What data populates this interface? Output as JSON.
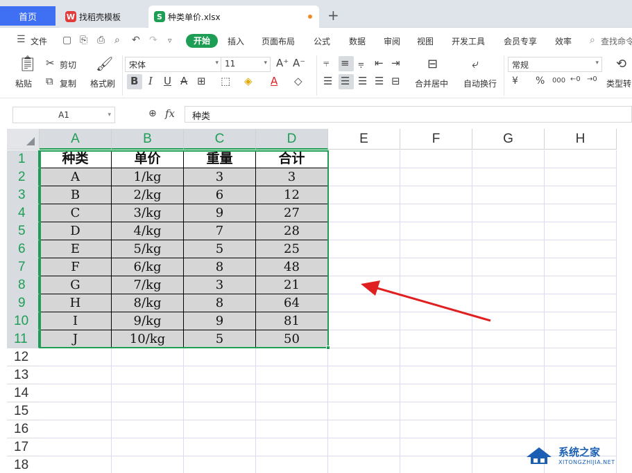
{
  "tabs": {
    "home": "首页",
    "template": "找稻壳模板",
    "file": "种类单价.xlsx",
    "add": "+"
  },
  "menu": {
    "file": "文件",
    "items": [
      "开始",
      "插入",
      "页面布局",
      "公式",
      "数据",
      "审阅",
      "视图",
      "开发工具",
      "会员专享",
      "效率"
    ],
    "search": "查找命令"
  },
  "ribbon": {
    "paste": "粘贴",
    "cut": "剪切",
    "copy": "复制",
    "format_painter": "格式刷",
    "font_name": "宋体",
    "font_size": "11",
    "merge_center": "合并居中",
    "wrap_text": "自动换行",
    "number_format": "常规",
    "type_convert": "类型转",
    "bold": "B",
    "italic": "I",
    "underline": "U",
    "grow_font": "A⁺",
    "shrink_font": "A⁻",
    "currency": "¥",
    "percent": "%",
    "thousands": "000"
  },
  "formula_bar": {
    "cell_ref": "A1",
    "fx": "fx",
    "content": "种类"
  },
  "sheet": {
    "columns": [
      "A",
      "B",
      "C",
      "D",
      "E",
      "F",
      "G",
      "H"
    ],
    "rows": [
      "1",
      "2",
      "3",
      "4",
      "5",
      "6",
      "7",
      "8",
      "9",
      "10",
      "11",
      "12",
      "13",
      "14",
      "15",
      "16",
      "17",
      "18"
    ],
    "header": [
      "种类",
      "单价",
      "重量",
      "合计"
    ],
    "data": [
      [
        "A",
        "1/kg",
        "3",
        "3"
      ],
      [
        "B",
        "2/kg",
        "6",
        "12"
      ],
      [
        "C",
        "3/kg",
        "9",
        "27"
      ],
      [
        "D",
        "4/kg",
        "7",
        "28"
      ],
      [
        "E",
        "5/kg",
        "5",
        "25"
      ],
      [
        "F",
        "6/kg",
        "8",
        "48"
      ],
      [
        "G",
        "7/kg",
        "3",
        "21"
      ],
      [
        "H",
        "8/kg",
        "8",
        "64"
      ],
      [
        "I",
        "9/kg",
        "9",
        "81"
      ],
      [
        "J",
        "10/kg",
        "5",
        "50"
      ]
    ],
    "selected_range": "A1:D11"
  },
  "watermark": {
    "title": "系统之家",
    "url": "XITONGZHIJIA.NET"
  },
  "colors": {
    "accent_green": "#1e9e55",
    "home_tab_blue": "#3f6ff2",
    "arrow_red": "#e02020"
  }
}
